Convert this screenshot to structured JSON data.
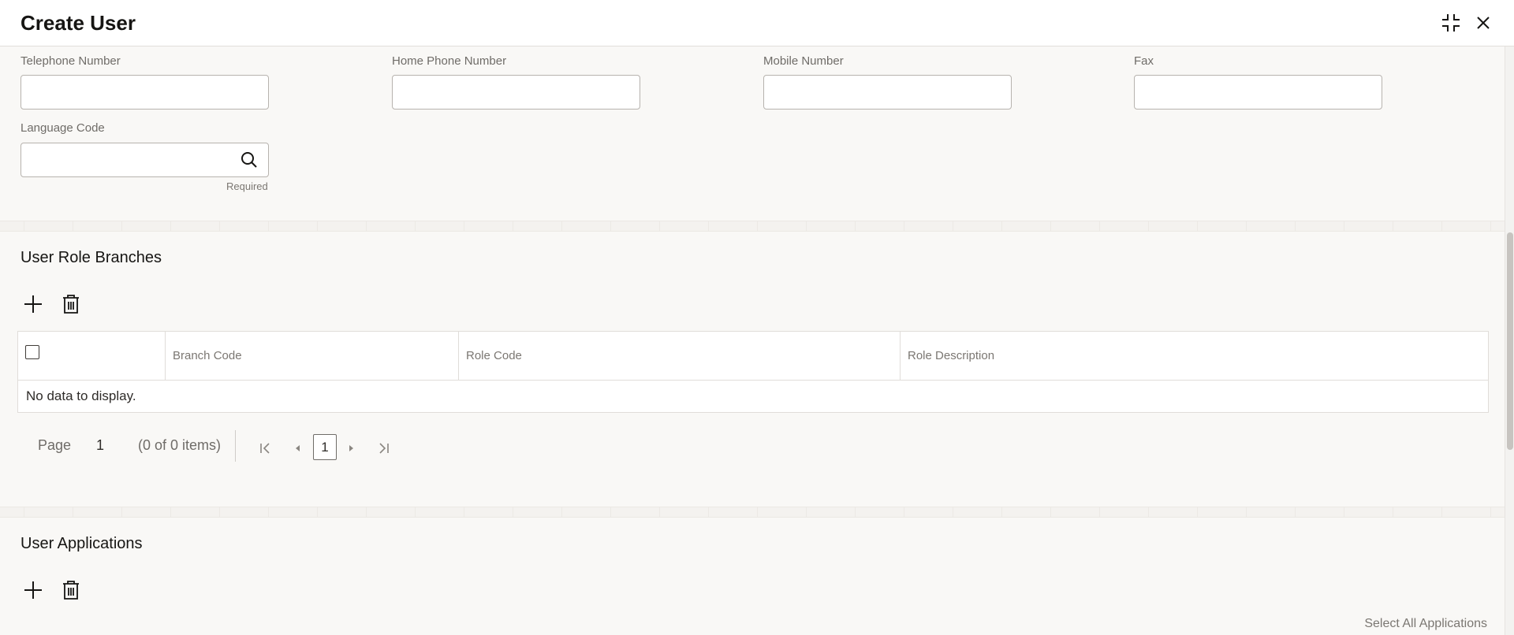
{
  "header": {
    "title": "Create User",
    "compress_icon": "compress-icon",
    "close_icon": "close-icon"
  },
  "contact": {
    "telephone_label": "Telephone Number",
    "telephone_value": "",
    "home_phone_label": "Home Phone Number",
    "home_phone_value": "",
    "mobile_label": "Mobile Number",
    "mobile_value": "",
    "fax_label": "Fax",
    "fax_value": "",
    "language_label": "Language Code",
    "language_value": "",
    "language_hint": "Required",
    "language_icon": "search-icon"
  },
  "role_branches": {
    "title": "User Role Branches",
    "add_icon": "plus-icon",
    "delete_icon": "trash-icon",
    "columns": [
      "Branch Code",
      "Role Code",
      "Role Description"
    ],
    "empty_text": "No data to display.",
    "pager": {
      "page_label": "Page",
      "page_number": "1",
      "items_text": "(0 of 0 items)",
      "current_page": "1"
    }
  },
  "applications": {
    "title": "User Applications",
    "add_icon": "plus-icon",
    "delete_icon": "trash-icon",
    "select_all": "Select All Applications"
  },
  "colors": {
    "background": "#f9f8f6",
    "header_bg": "#ffffff",
    "text": "#161513",
    "muted_text": "#6f6c68"
  }
}
